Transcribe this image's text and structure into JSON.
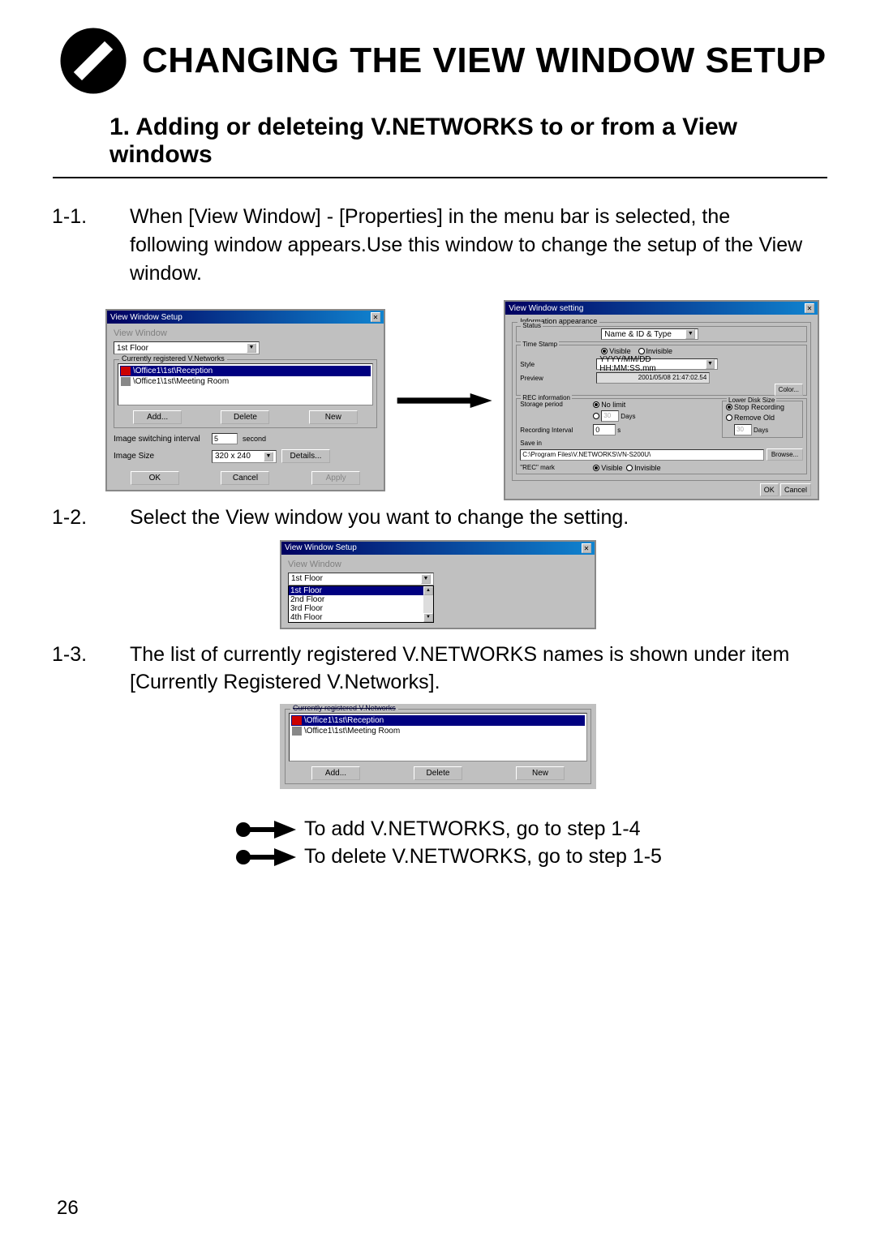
{
  "page_title": "CHANGING THE VIEW WINDOW SETUP",
  "section_heading": "1. Adding or deleteing V.NETWORKS to or from a View windows",
  "step_1_1": {
    "no": "1-1.",
    "text": "When [View Window] - [Properties] in the menu bar is selected, the following window appears.Use this window to change the setup of the View window."
  },
  "dialog1": {
    "title": "View Window Setup",
    "vw_label": "View Window",
    "vw_value": "1st Floor",
    "group_label": "Currently registered V.Networks",
    "items": [
      "\\Office1\\1st\\Reception",
      "\\Office1\\1st\\Meeting Room"
    ],
    "btn_add": "Add...",
    "btn_delete": "Delete",
    "btn_new": "New",
    "switch_label": "Image switching interval",
    "switch_val": "5",
    "switch_unit": "second",
    "size_label": "Image Size",
    "size_val": "320 x 240",
    "btn_details": "Details...",
    "btn_ok": "OK",
    "btn_cancel": "Cancel",
    "btn_apply": "Apply"
  },
  "dialog2": {
    "title": "View Window setting",
    "info_label": "Information appearance",
    "status_label": "Status",
    "status_val": "Name & ID & Type",
    "ts_label": "Time Stamp",
    "r_visible": "Visible",
    "r_invisible": "Invisible",
    "style_label": "Style",
    "style_val": "YYYY/MM/DD HH:MM:SS.mm",
    "preview_label": "Preview",
    "preview_val": "2001/05/08 21:47:02.54",
    "btn_color": "Color...",
    "rec_label": "REC information",
    "storage_label": "Storage period",
    "nolimit": "No limit",
    "days_unit": "Days",
    "disk_label": "Lower Disk Size",
    "stop_rec": "Stop Recording",
    "remove_old": "Remove Old",
    "rec_int_label": "Recording Interval",
    "rec_int_val": "0",
    "sec_unit": "s",
    "savein_label": "Save in",
    "savein_path": "C:\\Program Files\\V.NETWORKS\\VN-S200U\\",
    "btn_browse": "Browse...",
    "rec_mark_label": "\"REC\" mark",
    "btn_ok": "OK",
    "btn_cancel": "Cancel"
  },
  "step_1_2": {
    "no": "1-2.",
    "text": "Select the View window you want to change the setting."
  },
  "dropdown": {
    "title": "View Window Setup",
    "vw_label": "View Window",
    "selected": "1st Floor",
    "items": [
      "1st Floor",
      "2nd Floor",
      "3rd Floor",
      "4th Floor"
    ]
  },
  "step_1_3": {
    "no": "1-3.",
    "text": "The list of currently registered V.NETWORKS names is shown under item [Currently Registered V.Networks]."
  },
  "dialog3": {
    "group_label": "Currently registered V.Networks",
    "items": [
      "\\Office1\\1st\\Reception",
      "\\Office1\\1st\\Meeting Room"
    ],
    "btn_add": "Add...",
    "btn_delete": "Delete",
    "btn_new": "New"
  },
  "add_step": "To add V.NETWORKS, go to step 1-4",
  "del_step": "To delete V.NETWORKS, go to step 1-5",
  "page_number": "26"
}
